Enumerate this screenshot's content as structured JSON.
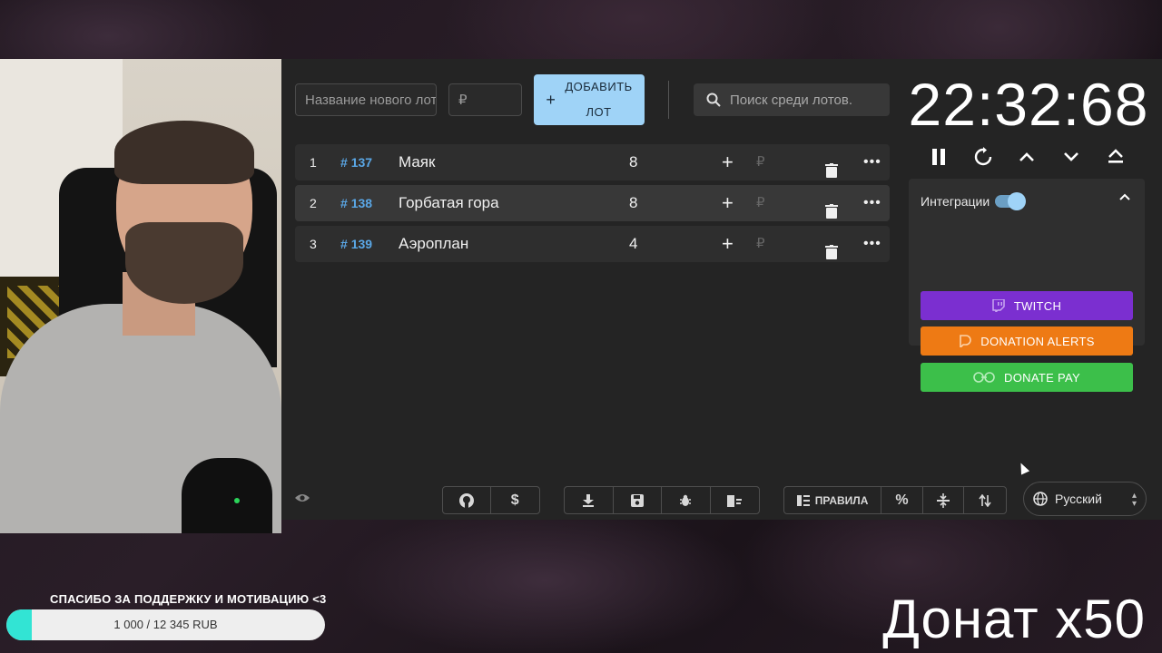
{
  "form": {
    "lot_name_placeholder": "Название нового лота",
    "amount_placeholder": "₽",
    "add_button_line1": "ДОБАВИТЬ",
    "add_button_line2": "ЛОТ",
    "search_placeholder": "Поиск среди лотов."
  },
  "lots": [
    {
      "num": "1",
      "id": "137",
      "name": "Маяк",
      "amount": "8",
      "rub": "₽"
    },
    {
      "num": "2",
      "id": "138",
      "name": "Горбатая гора",
      "amount": "8",
      "rub": "₽"
    },
    {
      "num": "3",
      "id": "139",
      "name": "Аэроплан",
      "amount": "4",
      "rub": "₽"
    }
  ],
  "timer": {
    "value": "22:32:68",
    "controls": [
      "pause-icon",
      "restart-icon",
      "chevron-up-icon",
      "chevron-down-icon",
      "eject-icon"
    ]
  },
  "integrations": {
    "title": "Интеграции",
    "enabled": true,
    "services": [
      {
        "label": "TWITCH",
        "color": "#7b2fd0",
        "icon": "twitch-icon"
      },
      {
        "label": "DONATION ALERTS",
        "color": "#ee7a14",
        "icon": "donation-alerts-icon"
      },
      {
        "label": "DONATE PAY",
        "color": "#3cbf4a",
        "icon": "donatepay-icon"
      }
    ]
  },
  "toolbar": {
    "rules_label": "ПРАВИЛА",
    "language": "Русский"
  },
  "overlay": {
    "thanks": "СПАСИБО ЗА ПОДДЕРЖКУ И МОТИВАЦИЮ <3",
    "progress_text": "1 000 / 12 345 RUB",
    "progress_fraction": 0.081,
    "donat": "Донат x50"
  }
}
